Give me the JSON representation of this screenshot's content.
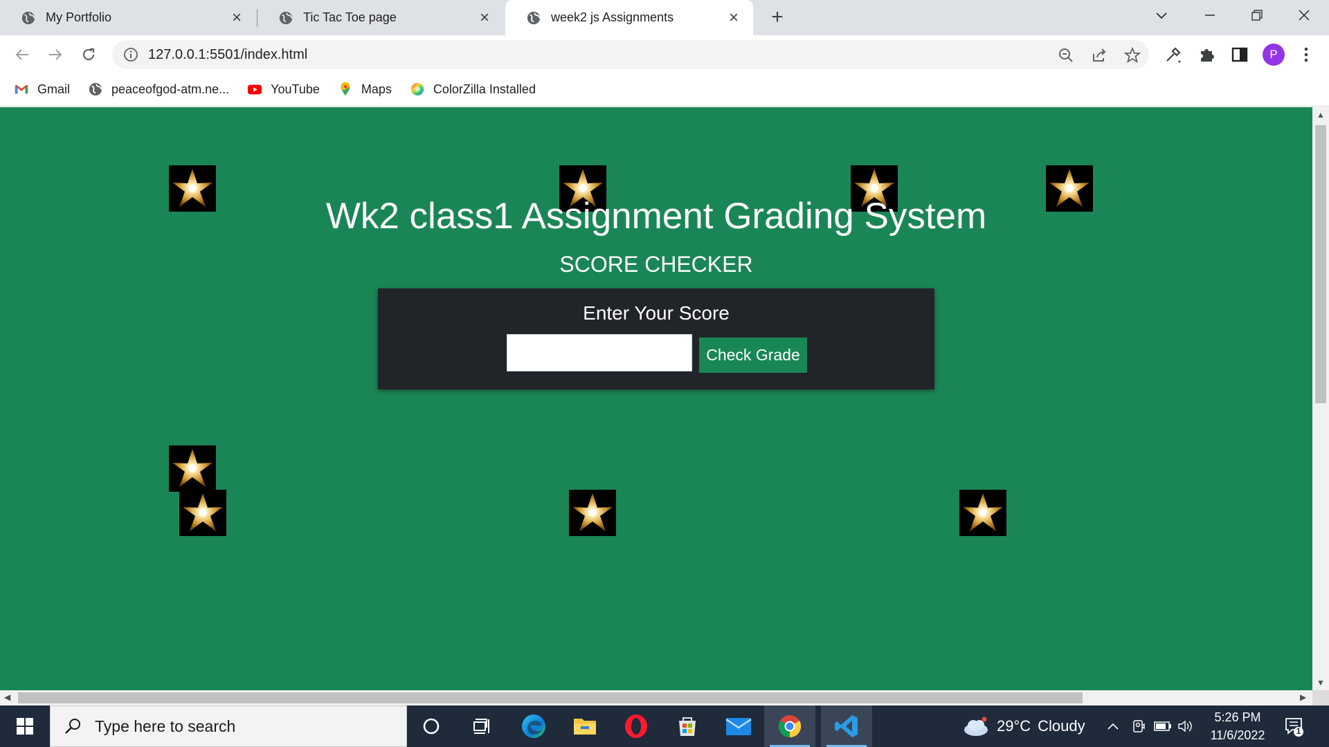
{
  "browser": {
    "tabs": [
      {
        "title": "My Portfolio",
        "active": false
      },
      {
        "title": "Tic Tac Toe page",
        "active": false
      },
      {
        "title": "week2 js Assignments",
        "active": true
      }
    ],
    "new_tab_label": "+",
    "url": "127.0.0.1:5501/index.html",
    "profile_initial": "P",
    "bookmarks": [
      {
        "label": "Gmail",
        "icon": "gmail-icon"
      },
      {
        "label": "peaceofgod-atm.ne...",
        "icon": "globe-icon"
      },
      {
        "label": "YouTube",
        "icon": "youtube-icon"
      },
      {
        "label": "Maps",
        "icon": "maps-icon"
      },
      {
        "label": "ColorZilla Installed",
        "icon": "colorzilla-icon"
      }
    ]
  },
  "page": {
    "background_color": "#1b8655",
    "title": "Wk2 class1 Assignment Grading System",
    "subtitle": "SCORE CHECKER",
    "score_box": {
      "label": "Enter Your Score",
      "input_value": "",
      "button_label": "Check Grade"
    },
    "decorations": {
      "star_count": 8,
      "icon": "gold-star-icon"
    }
  },
  "taskbar": {
    "search_placeholder": "Type here to search",
    "apps": [
      "cortana",
      "task-view",
      "edge",
      "file-explorer",
      "opera",
      "microsoft-store",
      "mail",
      "chrome",
      "vscode"
    ],
    "active_app": "chrome",
    "weather": {
      "temp": "29°C",
      "condition": "Cloudy"
    },
    "time": "5:26 PM",
    "date": "11/6/2022",
    "notification_count": "1"
  }
}
